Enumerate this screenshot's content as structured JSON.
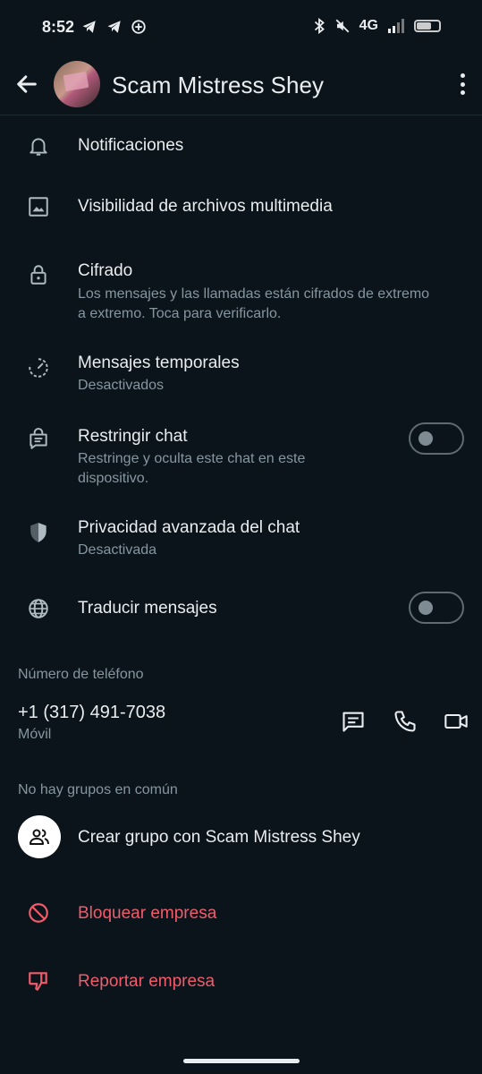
{
  "status_bar": {
    "time": "8:52",
    "network": "4G"
  },
  "header": {
    "title": "Scam Mistress Shey"
  },
  "settings": [
    {
      "title": "Notificaciones",
      "icon": "bell-icon"
    },
    {
      "title": "Visibilidad de archivos multimedia",
      "icon": "image-icon"
    },
    {
      "title": "Cifrado",
      "subtitle": "Los mensajes y las llamadas están cifrados de extremo a extremo. Toca para verificarlo.",
      "icon": "lock-icon"
    },
    {
      "title": "Mensajes temporales",
      "subtitle": "Desactivados",
      "icon": "timer-icon"
    },
    {
      "title": "Restringir chat",
      "subtitle": "Restringe y oculta este chat en este dispositivo.",
      "icon": "chat-lock-icon",
      "toggle": false
    },
    {
      "title": "Privacidad avanzada del chat",
      "subtitle": "Desactivada",
      "icon": "shield-icon"
    },
    {
      "title": "Traducir mensajes",
      "icon": "globe-icon",
      "toggle": false
    }
  ],
  "phone_section": {
    "label": "Número de teléfono",
    "number": "+1 (317) 491-7038",
    "type": "Móvil"
  },
  "groups_section": {
    "label": "No hay grupos en común",
    "create_label": "Crear grupo con Scam Mistress Shey"
  },
  "actions": {
    "block": "Bloquear empresa",
    "report": "Reportar empresa"
  },
  "colors": {
    "background": "#0b141a",
    "text": "#e9edef",
    "secondary": "#8696a0",
    "danger": "#f15c6d"
  }
}
